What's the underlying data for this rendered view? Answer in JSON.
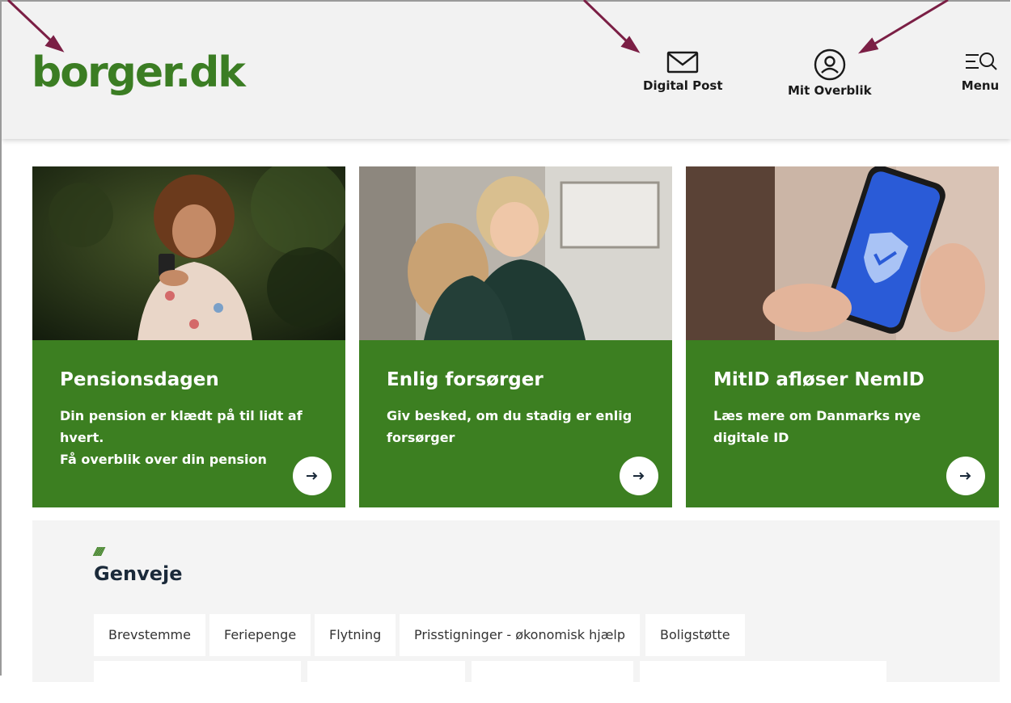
{
  "header": {
    "logo": "borger.dk",
    "digital_post": "Digital Post",
    "mit_overblik": "Mit Overblik",
    "menu": "Menu"
  },
  "cards": [
    {
      "title": "Pensionsdagen",
      "text_line1": "Din pension er klædt på til lidt af hvert.",
      "text_line2": "Få overblik over din pension"
    },
    {
      "title": "Enlig forsørger",
      "text_line1": "Giv besked, om du stadig er enlig forsørger",
      "text_line2": ""
    },
    {
      "title": "MitID afløser NemID",
      "text_line1": "Læs mere om Danmarks nye digitale ID",
      "text_line2": ""
    }
  ],
  "shortcuts": {
    "slashes": "//////",
    "title": "Genveje",
    "items": [
      "Brevstemme",
      "Feriepenge",
      "Flytning",
      "Prisstigninger - økonomisk hjælp",
      "Boligstøtte"
    ]
  },
  "colors": {
    "brand_green": "#3c7f21",
    "header_bg": "#f2f2f2",
    "annotation_arrow": "#7b1f45"
  },
  "icons": [
    "envelope-icon",
    "user-circle-icon",
    "menu-search-icon",
    "arrow-right-icon"
  ]
}
